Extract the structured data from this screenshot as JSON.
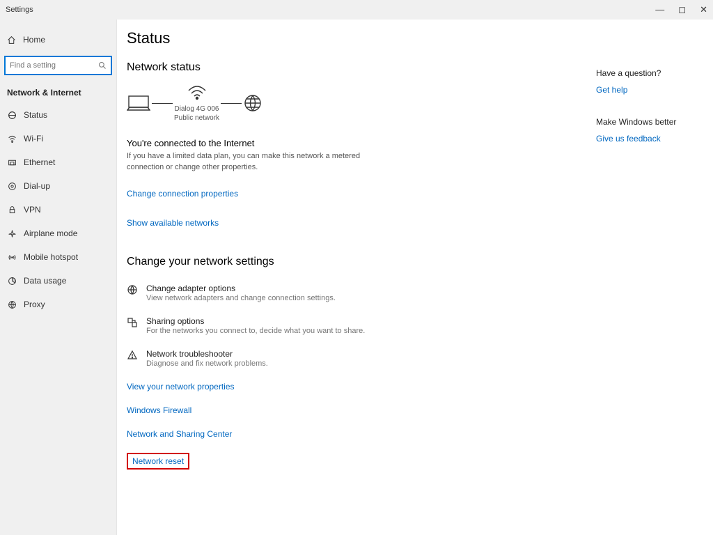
{
  "window": {
    "title": "Settings"
  },
  "sidebar": {
    "home": "Home",
    "search_placeholder": "Find a setting",
    "section": "Network & Internet",
    "items": [
      {
        "label": "Status"
      },
      {
        "label": "Wi-Fi"
      },
      {
        "label": "Ethernet"
      },
      {
        "label": "Dial-up"
      },
      {
        "label": "VPN"
      },
      {
        "label": "Airplane mode"
      },
      {
        "label": "Mobile hotspot"
      },
      {
        "label": "Data usage"
      },
      {
        "label": "Proxy"
      }
    ]
  },
  "main": {
    "title": "Status",
    "network_status": "Network status",
    "diagram": {
      "ssid": "Dialog 4G 006",
      "type": "Public network"
    },
    "connected_title": "You're connected to the Internet",
    "connected_desc": "If you have a limited data plan, you can make this network a metered connection or change other properties.",
    "link_change_props": "Change connection properties",
    "link_show_networks": "Show available networks",
    "change_header": "Change your network settings",
    "options": [
      {
        "title": "Change adapter options",
        "desc": "View network adapters and change connection settings."
      },
      {
        "title": "Sharing options",
        "desc": "For the networks you connect to, decide what you want to share."
      },
      {
        "title": "Network troubleshooter",
        "desc": "Diagnose and fix network problems."
      }
    ],
    "links": [
      "View your network properties",
      "Windows Firewall",
      "Network and Sharing Center",
      "Network reset"
    ]
  },
  "aside": {
    "q_head": "Have a question?",
    "q_link": "Get help",
    "fb_head": "Make Windows better",
    "fb_link": "Give us feedback"
  }
}
